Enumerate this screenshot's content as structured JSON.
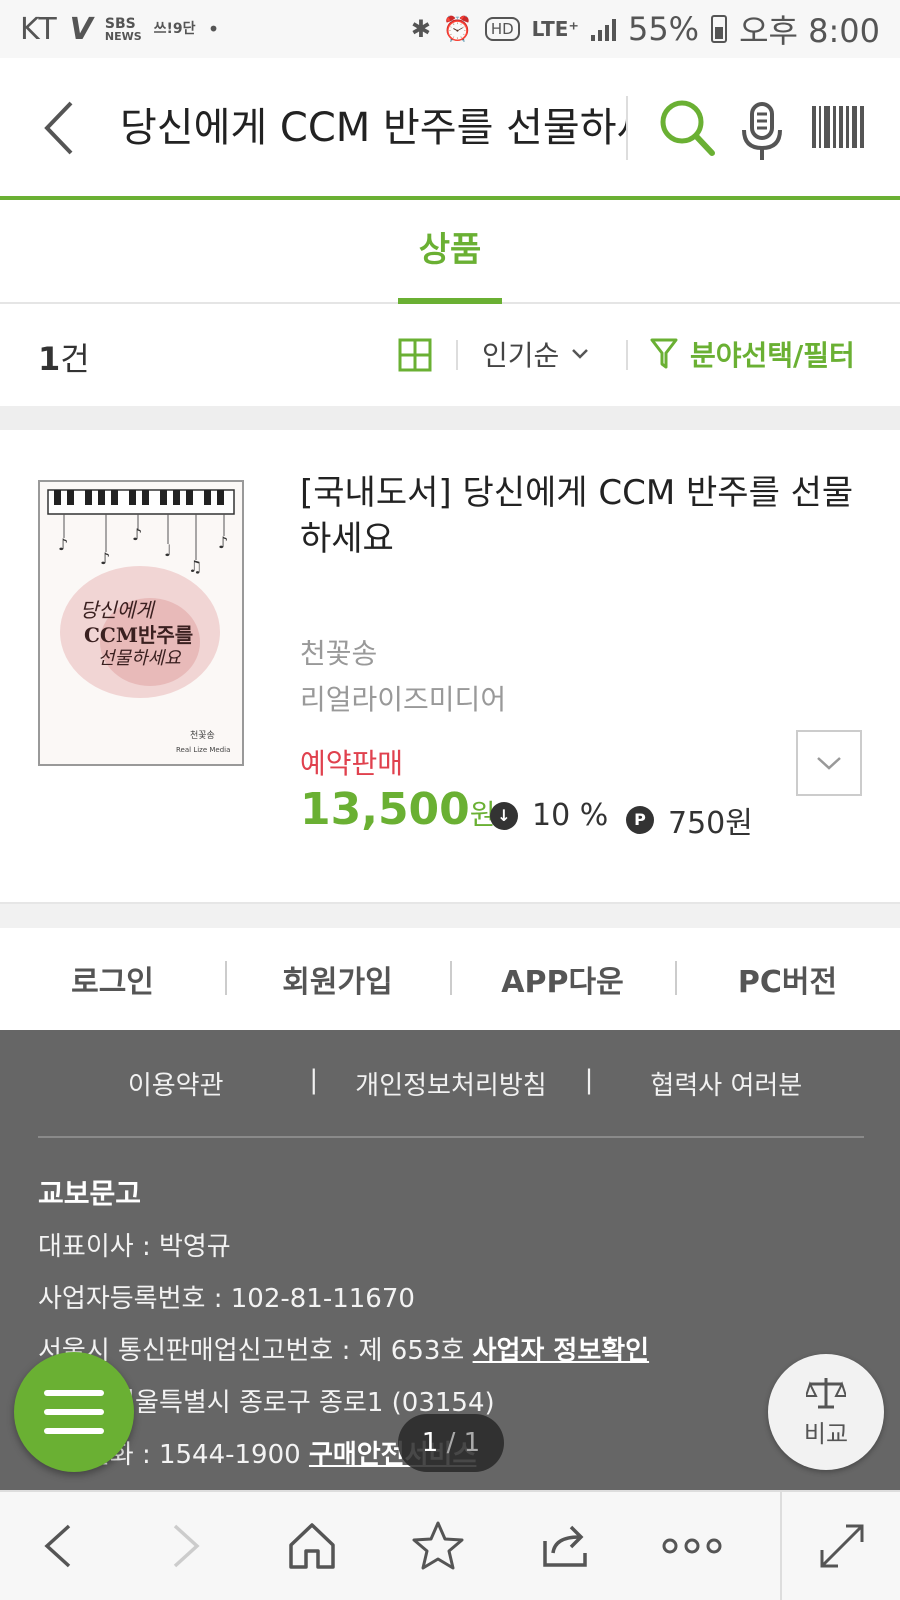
{
  "status_bar": {
    "carrier": "KT",
    "app_label_sbs": "SBS",
    "app_label_news": "NEWS",
    "app_label_mini": "쓰!9단",
    "battery": "55%",
    "time": "오후 8:00"
  },
  "search": {
    "query": "당신에게 CCM 반주를 선물하세요"
  },
  "tabs": [
    {
      "label": "상품",
      "active": true
    }
  ],
  "results": {
    "count_num": "1",
    "count_unit": "건",
    "sort_label": "인기순",
    "filter_label": "분야선택/필터"
  },
  "product": {
    "title": "[국내도서] 당신에게 CCM 반주를 선물하세요",
    "author": "천꽃송",
    "publisher": "리얼라이즈미디어",
    "sale_status": "예약판매",
    "price": "13,500",
    "price_unit": "원",
    "discount": "10 %",
    "discount_icon": "↓",
    "points": "750원",
    "points_icon": "P",
    "cover_text_line1": "당신에게",
    "cover_text_line2": "CCM반주를",
    "cover_text_line3": "선물하세요",
    "cover_author": "천꽃송",
    "cover_publisher": "Real Lize Media"
  },
  "footer_links": [
    "로그인",
    "회원가입",
    "APP다운",
    "PC버전"
  ],
  "footer": {
    "policies": [
      "이용약관",
      "개인정보처리방침",
      "협력사 여러분"
    ],
    "company": "교보문고",
    "ceo": "대표이사 : 박영규",
    "business_no": "사업자등록번호 : 102-81-11670",
    "mail_order_no": "서울시 통신판매업신고번호 : 제 653호",
    "business_info_link": "사업자 정보확인",
    "address": "주소 : 서울특별시 종로구 종로1 (03154)",
    "phone": "대표전화 : 1544-1900",
    "purchase_safety_link": "구매안전서비스"
  },
  "pager": {
    "current": "1",
    "total": "/ 1"
  },
  "compare_label": "비교",
  "colors": {
    "accent": "#6ab033",
    "sale_red": "#e0414e",
    "footer_bg": "#666666"
  },
  "icons": {
    "back": "chevron-left-icon",
    "search": "search-icon",
    "mic": "microphone-icon",
    "barcode": "barcode-icon",
    "grid": "grid-view-icon",
    "filter": "filter-icon",
    "compare": "scale-icon",
    "menu": "hamburger-icon"
  }
}
